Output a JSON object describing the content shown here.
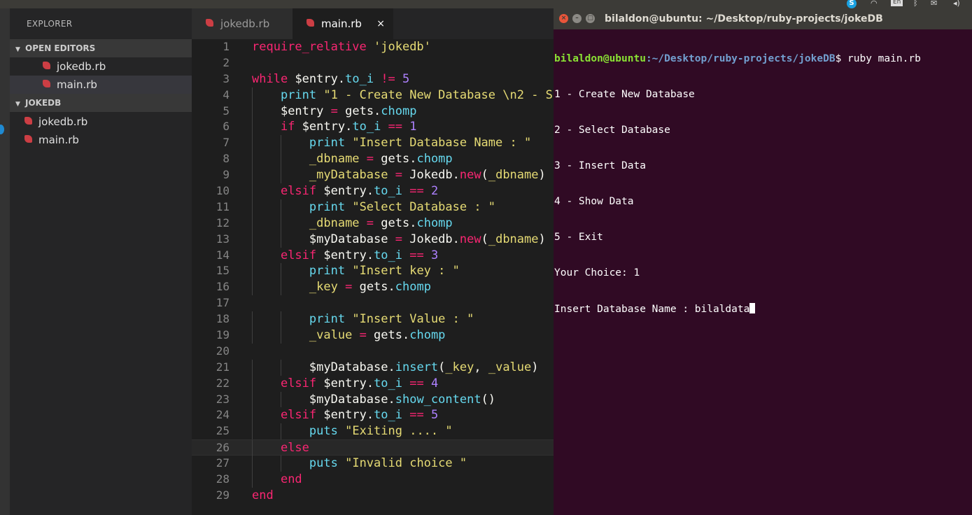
{
  "sidebar": {
    "title": "EXPLORER",
    "open_editors_label": "OPEN EDITORS",
    "open_editors": [
      "jokedb.rb",
      "main.rb"
    ],
    "project_label": "JOKEDB",
    "files": [
      "jokedb.rb",
      "main.rb"
    ]
  },
  "tabs": [
    {
      "label": "jokedb.rb"
    },
    {
      "label": "main.rb",
      "close": "×"
    }
  ],
  "code_lines": [
    [
      [
        "kw",
        "require_relative"
      ],
      [
        "plain",
        " "
      ],
      [
        "str",
        "'jokedb'"
      ]
    ],
    [],
    [
      [
        "kw",
        "while"
      ],
      [
        "plain",
        " "
      ],
      [
        "gv",
        "$entry"
      ],
      [
        "plain",
        "."
      ],
      [
        "meth",
        "to_i"
      ],
      [
        "plain",
        " "
      ],
      [
        "kw",
        "!="
      ],
      [
        "plain",
        " "
      ],
      [
        "num",
        "5"
      ]
    ],
    [
      [
        "plain",
        "    "
      ],
      [
        "fn",
        "print"
      ],
      [
        "plain",
        " "
      ],
      [
        "str",
        "\"1 - Create New Database \\n2 - S"
      ]
    ],
    [
      [
        "plain",
        "    "
      ],
      [
        "gv",
        "$entry"
      ],
      [
        "plain",
        " "
      ],
      [
        "kw",
        "="
      ],
      [
        "plain",
        " gets."
      ],
      [
        "meth",
        "chomp"
      ]
    ],
    [
      [
        "plain",
        "    "
      ],
      [
        "kw",
        "if"
      ],
      [
        "plain",
        " "
      ],
      [
        "gv",
        "$entry"
      ],
      [
        "plain",
        "."
      ],
      [
        "meth",
        "to_i"
      ],
      [
        "plain",
        " "
      ],
      [
        "kw",
        "=="
      ],
      [
        "plain",
        " "
      ],
      [
        "num",
        "1"
      ]
    ],
    [
      [
        "plain",
        "        "
      ],
      [
        "fn",
        "print"
      ],
      [
        "plain",
        " "
      ],
      [
        "str",
        "\"Insert Database Name : \""
      ]
    ],
    [
      [
        "plain",
        "        "
      ],
      [
        "str",
        "_dbname"
      ],
      [
        "plain",
        " "
      ],
      [
        "kw",
        "="
      ],
      [
        "plain",
        " gets."
      ],
      [
        "meth",
        "chomp"
      ]
    ],
    [
      [
        "plain",
        "        "
      ],
      [
        "str",
        "_myDatabase"
      ],
      [
        "plain",
        " "
      ],
      [
        "kw",
        "="
      ],
      [
        "plain",
        " Jokedb."
      ],
      [
        "kw",
        "new"
      ],
      [
        "plain",
        "("
      ],
      [
        "str",
        "_dbname"
      ],
      [
        "plain",
        ")"
      ]
    ],
    [
      [
        "plain",
        "    "
      ],
      [
        "kw",
        "elsif"
      ],
      [
        "plain",
        " "
      ],
      [
        "gv",
        "$entry"
      ],
      [
        "plain",
        "."
      ],
      [
        "meth",
        "to_i"
      ],
      [
        "plain",
        " "
      ],
      [
        "kw",
        "=="
      ],
      [
        "plain",
        " "
      ],
      [
        "num",
        "2"
      ]
    ],
    [
      [
        "plain",
        "        "
      ],
      [
        "fn",
        "print"
      ],
      [
        "plain",
        " "
      ],
      [
        "str",
        "\"Select Database : \""
      ]
    ],
    [
      [
        "plain",
        "        "
      ],
      [
        "str",
        "_dbname"
      ],
      [
        "plain",
        " "
      ],
      [
        "kw",
        "="
      ],
      [
        "plain",
        " gets."
      ],
      [
        "meth",
        "chomp"
      ]
    ],
    [
      [
        "plain",
        "        "
      ],
      [
        "gv",
        "$myDatabase"
      ],
      [
        "plain",
        " "
      ],
      [
        "kw",
        "="
      ],
      [
        "plain",
        " Jokedb."
      ],
      [
        "kw",
        "new"
      ],
      [
        "plain",
        "("
      ],
      [
        "str",
        "_dbname"
      ],
      [
        "plain",
        ")"
      ]
    ],
    [
      [
        "plain",
        "    "
      ],
      [
        "kw",
        "elsif"
      ],
      [
        "plain",
        " "
      ],
      [
        "gv",
        "$entry"
      ],
      [
        "plain",
        "."
      ],
      [
        "meth",
        "to_i"
      ],
      [
        "plain",
        " "
      ],
      [
        "kw",
        "=="
      ],
      [
        "plain",
        " "
      ],
      [
        "num",
        "3"
      ]
    ],
    [
      [
        "plain",
        "        "
      ],
      [
        "fn",
        "print"
      ],
      [
        "plain",
        " "
      ],
      [
        "str",
        "\"Insert key : \""
      ]
    ],
    [
      [
        "plain",
        "        "
      ],
      [
        "str",
        "_key"
      ],
      [
        "plain",
        " "
      ],
      [
        "kw",
        "="
      ],
      [
        "plain",
        " gets."
      ],
      [
        "meth",
        "chomp"
      ]
    ],
    [],
    [
      [
        "plain",
        "        "
      ],
      [
        "fn",
        "print"
      ],
      [
        "plain",
        " "
      ],
      [
        "str",
        "\"Insert Value : \""
      ]
    ],
    [
      [
        "plain",
        "        "
      ],
      [
        "str",
        "_value"
      ],
      [
        "plain",
        " "
      ],
      [
        "kw",
        "="
      ],
      [
        "plain",
        " gets."
      ],
      [
        "meth",
        "chomp"
      ]
    ],
    [],
    [
      [
        "plain",
        "        "
      ],
      [
        "gv",
        "$myDatabase"
      ],
      [
        "plain",
        "."
      ],
      [
        "meth",
        "insert"
      ],
      [
        "plain",
        "("
      ],
      [
        "str",
        "_key"
      ],
      [
        "plain",
        ", "
      ],
      [
        "str",
        "_value"
      ],
      [
        "plain",
        ")"
      ]
    ],
    [
      [
        "plain",
        "    "
      ],
      [
        "kw",
        "elsif"
      ],
      [
        "plain",
        " "
      ],
      [
        "gv",
        "$entry"
      ],
      [
        "plain",
        "."
      ],
      [
        "meth",
        "to_i"
      ],
      [
        "plain",
        " "
      ],
      [
        "kw",
        "=="
      ],
      [
        "plain",
        " "
      ],
      [
        "num",
        "4"
      ]
    ],
    [
      [
        "plain",
        "        "
      ],
      [
        "gv",
        "$myDatabase"
      ],
      [
        "plain",
        "."
      ],
      [
        "meth",
        "show_content"
      ],
      [
        "plain",
        "()"
      ]
    ],
    [
      [
        "plain",
        "    "
      ],
      [
        "kw",
        "elsif"
      ],
      [
        "plain",
        " "
      ],
      [
        "gv",
        "$entry"
      ],
      [
        "plain",
        "."
      ],
      [
        "meth",
        "to_i"
      ],
      [
        "plain",
        " "
      ],
      [
        "kw",
        "=="
      ],
      [
        "plain",
        " "
      ],
      [
        "num",
        "5"
      ]
    ],
    [
      [
        "plain",
        "        "
      ],
      [
        "fn",
        "puts"
      ],
      [
        "plain",
        " "
      ],
      [
        "str",
        "\"Exiting .... \""
      ]
    ],
    [
      [
        "plain",
        "    "
      ],
      [
        "kw",
        "else"
      ]
    ],
    [
      [
        "plain",
        "        "
      ],
      [
        "fn",
        "puts"
      ],
      [
        "plain",
        " "
      ],
      [
        "str",
        "\"Invalid choice \""
      ]
    ],
    [
      [
        "plain",
        "    "
      ],
      [
        "kw",
        "end"
      ]
    ],
    [
      [
        "kw",
        "end"
      ]
    ]
  ],
  "cursor_line": 26,
  "terminal": {
    "title": "bilaldon@ubuntu: ~/Desktop/ruby-projects/jokeDB",
    "prompt_user": "bilaldon@ubuntu",
    "prompt_path": ":~/Desktop/ruby-projects/jokeDB",
    "prompt_cmd": "$ ruby main.rb",
    "output": [
      "1 - Create New Database",
      "2 - Select Database",
      "3 - Insert Data",
      "4 - Show Data",
      "5 - Exit",
      "Your Choice: 1"
    ],
    "input_line": "Insert Database Name : bilaldata"
  },
  "tray": {
    "lang": "En"
  }
}
